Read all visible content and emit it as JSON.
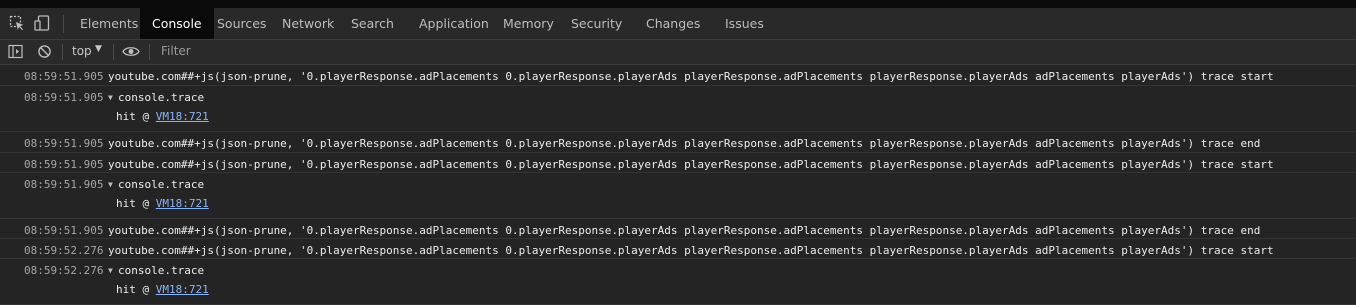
{
  "tabs": {
    "elements": "Elements",
    "console": "Console",
    "sources": "Sources",
    "network": "Network",
    "search": "Search",
    "application": "Application",
    "memory": "Memory",
    "security": "Security",
    "changes": "Changes",
    "issues": "Issues",
    "active": "Console"
  },
  "toolbar": {
    "context": "top",
    "filter_placeholder": "Filter"
  },
  "icons": {
    "inspect": "inspect-element-icon",
    "device": "device-toolbar-icon",
    "sidebar": "show-sidebar-icon",
    "clear": "clear-console-icon",
    "dropdown": "chevron-down-icon",
    "live_expression": "eye-icon"
  },
  "log": [
    {
      "time": "08:59:51.905",
      "text": "youtube.com##+js(json-prune, '0.playerResponse.adPlacements 0.playerResponse.playerAds playerResponse.adPlacements playerResponse.playerAds adPlacements playerAds') trace start"
    },
    {
      "time": "08:59:51.905",
      "trace_label": "console.trace",
      "trace_prefix": "hit @ ",
      "trace_link": "VM18:721"
    },
    {
      "time": "08:59:51.905",
      "text": "youtube.com##+js(json-prune, '0.playerResponse.adPlacements 0.playerResponse.playerAds playerResponse.adPlacements playerResponse.playerAds adPlacements playerAds') trace end"
    },
    {
      "time": "08:59:51.905",
      "text": "youtube.com##+js(json-prune, '0.playerResponse.adPlacements 0.playerResponse.playerAds playerResponse.adPlacements playerResponse.playerAds adPlacements playerAds') trace start"
    },
    {
      "time": "08:59:51.905",
      "trace_label": "console.trace",
      "trace_prefix": "hit @ ",
      "trace_link": "VM18:721"
    },
    {
      "time": "08:59:51.905",
      "text": "youtube.com##+js(json-prune, '0.playerResponse.adPlacements 0.playerResponse.playerAds playerResponse.adPlacements playerResponse.playerAds adPlacements playerAds') trace end"
    },
    {
      "time": "08:59:52.276",
      "text": "youtube.com##+js(json-prune, '0.playerResponse.adPlacements 0.playerResponse.playerAds playerResponse.adPlacements playerResponse.playerAds adPlacements playerAds') trace start"
    },
    {
      "time": "08:59:52.276",
      "trace_label": "console.trace",
      "trace_prefix": "hit @ ",
      "trace_link": "VM18:721"
    }
  ],
  "colors": {
    "background": "#242424",
    "toolbar": "#292929",
    "active_tab": "#0a0a0a",
    "text": "#ececec",
    "timestamp": "#a6a6a6",
    "link": "#8ab4f8"
  }
}
